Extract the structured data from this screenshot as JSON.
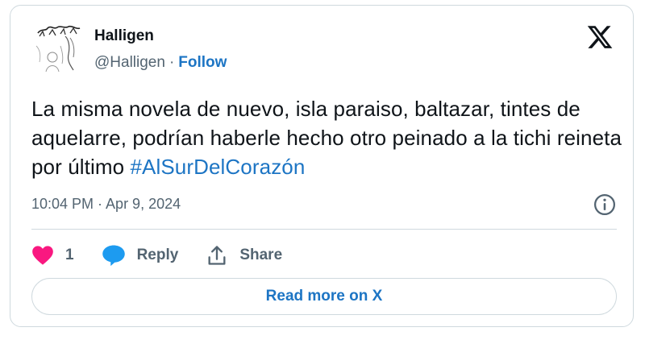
{
  "author": {
    "name": "Halligen",
    "handle": "@Halligen",
    "separator": "·",
    "follow_label": "Follow",
    "avatar_icon": "sketch-avatar-icon"
  },
  "tweet": {
    "text": "La misma novela de nuevo, isla paraiso, baltazar, tintes de aquelarre, podrían haberle hecho otro peinado a la tichi reineta por último ",
    "hashtag": "#AlSurDelCorazón",
    "timestamp": "10:04 PM · Apr 9, 2024"
  },
  "actions": {
    "like_count": "1",
    "reply_label": "Reply",
    "share_label": "Share"
  },
  "read_more_label": "Read more on X",
  "colors": {
    "link": "#1d75c4",
    "heart": "#f91880",
    "reply_bubble": "#1d9bf0",
    "muted": "#536471",
    "border": "#cfd9de"
  }
}
